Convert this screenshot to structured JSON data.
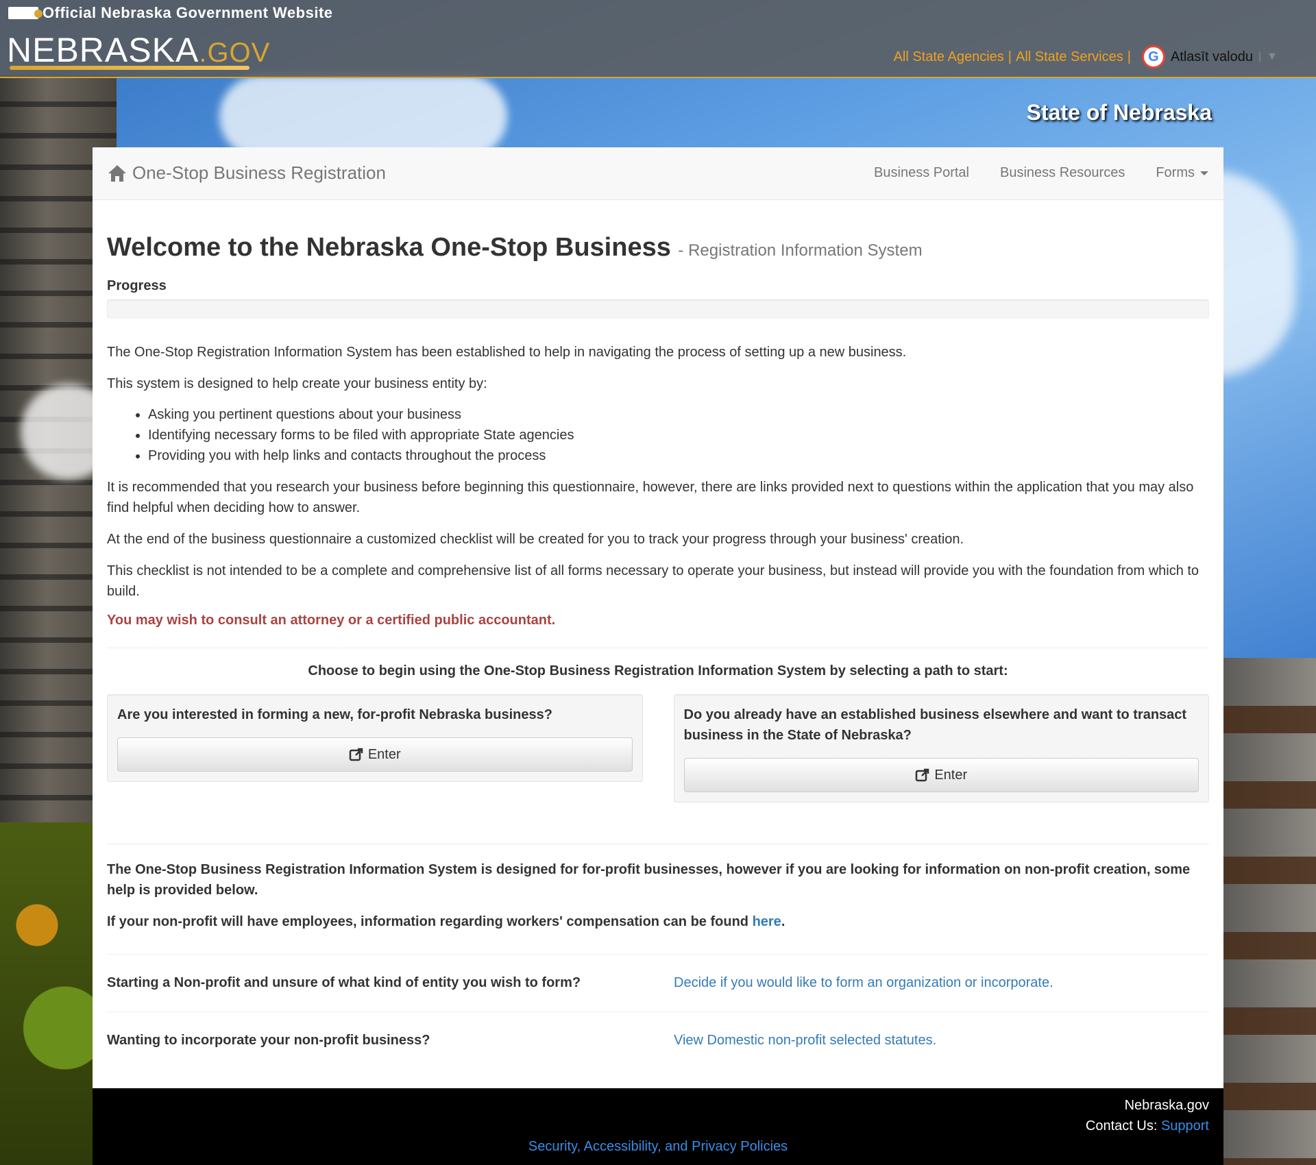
{
  "gov_bar": {
    "official_text": "Official Nebraska Government Website",
    "logo_main": "NEBRASKA",
    "logo_suffix": ".GOV",
    "links": [
      "All State Agencies",
      "All State Services"
    ],
    "separator": "|",
    "translate_label": "Atlasīt valodu",
    "translate_caret": "▼"
  },
  "state_title": "State of Nebraska",
  "navbar": {
    "brand": "One-Stop Business Registration",
    "links": [
      "Business Portal",
      "Business Resources",
      "Forms"
    ]
  },
  "main": {
    "title": "Welcome to the Nebraska One-Stop Business",
    "subtitle": "- Registration Information System",
    "progress_label": "Progress",
    "progress_percent": 0,
    "intro": "The One-Stop Registration Information System has been established to help in navigating the process of setting up a new business.",
    "designed": "This system is designed to help create your business entity by:",
    "bullets": [
      "Asking you pertinent questions about your business",
      "Identifying necessary forms to be filed with appropriate State agencies",
      "Providing you with help links and contacts throughout the process"
    ],
    "recommend": "It is recommended that you research your business before beginning this questionnaire, however, there are links provided next to questions within the application that you may also find helpful when deciding how to answer.",
    "checklist": "At the end of the business questionnaire a customized checklist will be created for you to track your progress through your business' creation.",
    "not_intended": "This checklist is not intended to be a complete and comprehensive list of all forms necessary to operate your business, but instead will provide you with the foundation from which to build.",
    "warning": "You may wish to consult an attorney or a certified public accountant.",
    "choose": "Choose to begin using the One-Stop Business Registration Information System by selecting a path to start:",
    "paths": [
      {
        "question": "Are you interested in forming a new, for-profit Nebraska business?",
        "button": "Enter"
      },
      {
        "question": "Do you already have an established business elsewhere and want to transact business in the State of Nebraska?",
        "button": "Enter"
      }
    ],
    "nonprofit_note": "The One-Stop Business Registration Information System is designed for for-profit businesses, however if you are looking for information on non-profit creation, some help is provided below.",
    "workers_comp_prefix": "If your non-profit will have employees, information regarding workers' compensation can be found",
    "workers_comp_link": "here",
    "workers_comp_suffix": ".",
    "nonprofit_rows": [
      {
        "question": "Starting a Non-profit and unsure of what kind of entity you wish to form?",
        "link": "Decide if you would like to form an organization or incorporate."
      },
      {
        "question": "Wanting to incorporate your non-profit business?",
        "link": "View Domestic non-profit selected statutes."
      }
    ]
  },
  "footer": {
    "site": "Nebraska.gov",
    "contact_label": "Contact Us:",
    "contact_link": "Support",
    "policies": "Security, Accessibility, and Privacy Policies"
  },
  "colors": {
    "accent": "#337ab7",
    "gov_gold": "#d8a531",
    "warning": "#a94442"
  }
}
